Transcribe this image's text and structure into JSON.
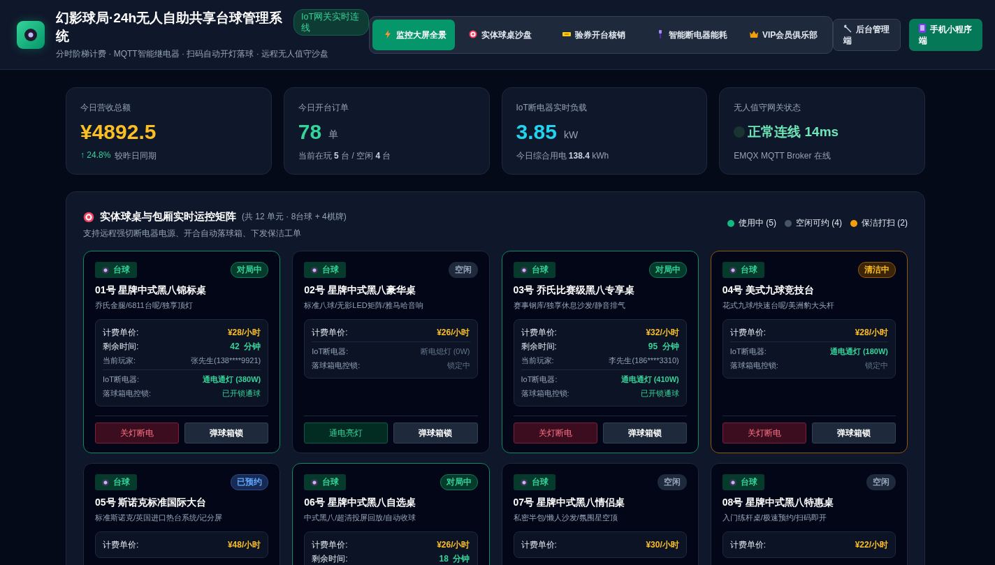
{
  "header": {
    "title": "幻影球局·24h无人自助共享台球管理系统",
    "subtitle": "分时阶梯计费 · MQTT智能继电器 · 扫码自动开灯落球 · 远程无人值守沙盘",
    "badge": "IoT网关实时连线"
  },
  "nav": [
    {
      "label": "监控大屏全景",
      "selected": true
    },
    {
      "label": "实体球桌沙盘",
      "selected": false
    },
    {
      "label": "验券开台核销",
      "selected": false
    },
    {
      "label": "智能断电器能耗",
      "selected": false
    },
    {
      "label": "VIP会员俱乐部",
      "selected": false
    }
  ],
  "actions": [
    {
      "label": "后台管理端",
      "kind": "admin"
    },
    {
      "label": "手机小程序端",
      "kind": "mini"
    }
  ],
  "stats": [
    {
      "label": "今日营收总额",
      "value": "¥4892.5",
      "color": "#fbbf24",
      "trend": "↑ 24.8%",
      "sub": "较昨日同期"
    },
    {
      "label": "今日开台订单",
      "value": "78",
      "unit": "单",
      "color": "#34d399",
      "sub": "当前在玩 **5** 台 / 空闲 **4** 台"
    },
    {
      "label": "IoT断电器实时负载",
      "value": "3.85",
      "unit": "kW",
      "color": "#22d3ee",
      "sub": "今日综合用电 **138.4** kWh"
    },
    {
      "label": "无人值守网关状态",
      "value": "正常连线 14ms",
      "color": "#6ee7b7",
      "kind": "status",
      "sub": "EMQX MQTT Broker 在线"
    }
  ],
  "section": {
    "title": "实体球桌与包厢实时运控矩阵",
    "count": "(共 12 单元 · 8台球 + 4棋牌)",
    "desc": "支持远程强切断电器电源、开合自动落球箱、下发保洁工单",
    "legend": [
      {
        "label": "使用中 (5)",
        "color": "#10b981"
      },
      {
        "label": "空闲可约 (4)",
        "color": "#475569"
      },
      {
        "label": "保洁打扫 (2)",
        "color": "#f59e0b"
      }
    ]
  },
  "tables": [
    {
      "tag": "台球",
      "status": "对局中",
      "kind": "playing",
      "name": "01号 星牌中式黑八锦标桌",
      "desc": "乔氏金腿/6811台呢/独享顶灯",
      "rows": [
        {
          "label": "计费单价:",
          "value": "¥28/小时",
          "kind": "price"
        },
        {
          "label": "剩余时间:",
          "value": "42",
          "unit": "分钟",
          "kind": "remain"
        },
        {
          "label": "当前玩家:",
          "value": "张先生(138****9921)",
          "kind": "player"
        },
        {
          "label": "IoT断电器:",
          "value": "通电通灯 (380W)",
          "kind": "breaker",
          "on": true
        },
        {
          "label": "落球箱电控锁:",
          "value": "已开锁通球",
          "kind": "lock",
          "on": true
        }
      ],
      "power": {
        "label": "关灯断电",
        "on": true
      },
      "lock_button": "弹球箱锁"
    },
    {
      "tag": "台球",
      "status": "空闲",
      "kind": "idle",
      "name": "02号 星牌中式黑八豪华桌",
      "desc": "标准八球/无影LED矩阵/雅马哈音响",
      "rows": [
        {
          "label": "计费单价:",
          "value": "¥26/小时",
          "kind": "price"
        },
        {
          "label": "IoT断电器:",
          "value": "断电熄灯 (0W)",
          "kind": "breaker",
          "on": false
        },
        {
          "label": "落球箱电控锁:",
          "value": "锁定中",
          "kind": "lock",
          "on": false
        }
      ],
      "power": {
        "label": "通电亮灯",
        "on": false
      },
      "lock_button": "弹球箱锁"
    },
    {
      "tag": "台球",
      "status": "对局中",
      "kind": "playing",
      "name": "03号 乔氏比赛级黑八专享桌",
      "desc": "赛事钢库/独享休息沙发/静音排气",
      "rows": [
        {
          "label": "计费单价:",
          "value": "¥32/小时",
          "kind": "price"
        },
        {
          "label": "剩余时间:",
          "value": "95",
          "unit": "分钟",
          "kind": "remain"
        },
        {
          "label": "当前玩家:",
          "value": "李先生(186****3310)",
          "kind": "player"
        },
        {
          "label": "IoT断电器:",
          "value": "通电通灯 (410W)",
          "kind": "breaker",
          "on": true
        },
        {
          "label": "落球箱电控锁:",
          "value": "已开锁通球",
          "kind": "lock",
          "on": true
        }
      ],
      "power": {
        "label": "关灯断电",
        "on": true
      },
      "lock_button": "弹球箱锁"
    },
    {
      "tag": "台球",
      "status": "清洁中",
      "kind": "cleaning",
      "name": "04号 美式九球竞技台",
      "desc": "花式九球/快速台呢/美洲豹大头杆",
      "rows": [
        {
          "label": "计费单价:",
          "value": "¥28/小时",
          "kind": "price"
        },
        {
          "label": "IoT断电器:",
          "value": "通电通灯 (180W)",
          "kind": "breaker",
          "on": true
        },
        {
          "label": "落球箱电控锁:",
          "value": "锁定中",
          "kind": "lock",
          "on": false
        }
      ],
      "power": {
        "label": "关灯断电",
        "on": true
      },
      "lock_button": "弹球箱锁"
    },
    {
      "tag": "台球",
      "status": "已预约",
      "kind": "reserved",
      "name": "05号 斯诺克标准国际大台",
      "desc": "标准斯诺克/英国进口热台系统/记分屏",
      "rows": [
        {
          "label": "计费单价:",
          "value": "¥48/小时",
          "kind": "price"
        }
      ]
    },
    {
      "tag": "台球",
      "status": "对局中",
      "kind": "playing",
      "name": "06号 星牌中式黑八自选桌",
      "desc": "中式黑八/超清投屏回放/自动收球",
      "rows": [
        {
          "label": "计费单价:",
          "value": "¥26/小时",
          "kind": "price"
        },
        {
          "label": "剩余时间:",
          "value": "18",
          "unit": "分钟",
          "kind": "remain"
        }
      ]
    },
    {
      "tag": "台球",
      "status": "空闲",
      "kind": "idle",
      "name": "07号 星牌中式黑八情侣桌",
      "desc": "私密半包/懒人沙发/氛围星空顶",
      "rows": [
        {
          "label": "计费单价:",
          "value": "¥30/小时",
          "kind": "price"
        }
      ]
    },
    {
      "tag": "台球",
      "status": "空闲",
      "kind": "idle",
      "name": "08号 星牌中式黑八特惠桌",
      "desc": "入门练杆桌/极速预约/扫码即开",
      "rows": [
        {
          "label": "计费单价:",
          "value": "¥22/小时",
          "kind": "price"
        }
      ]
    }
  ]
}
